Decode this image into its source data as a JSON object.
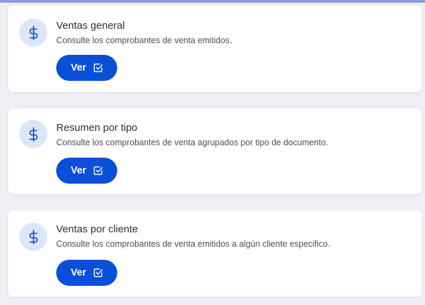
{
  "theme": {
    "accent": "#0a4fd8",
    "icon_bg": "#dde6f7",
    "icon_fg": "#1f57d6",
    "page_bg": "#eef0f5"
  },
  "cards": [
    {
      "icon": "dollar-icon",
      "title": "Ventas general",
      "description": "Consulte los comprobantes de venta emitidos.",
      "button_label": "Ver",
      "button_icon": "check-square-icon"
    },
    {
      "icon": "dollar-icon",
      "title": "Resumen por tipo",
      "description": "Consulte los comprobantes de venta agrupados por tipo de documento.",
      "button_label": "Ver",
      "button_icon": "check-square-icon"
    },
    {
      "icon": "dollar-icon",
      "title": "Ventas por cliente",
      "description": "Consulte los comprobantes de venta emitidos a algún cliente especifico.",
      "button_label": "Ver",
      "button_icon": "check-square-icon"
    }
  ]
}
